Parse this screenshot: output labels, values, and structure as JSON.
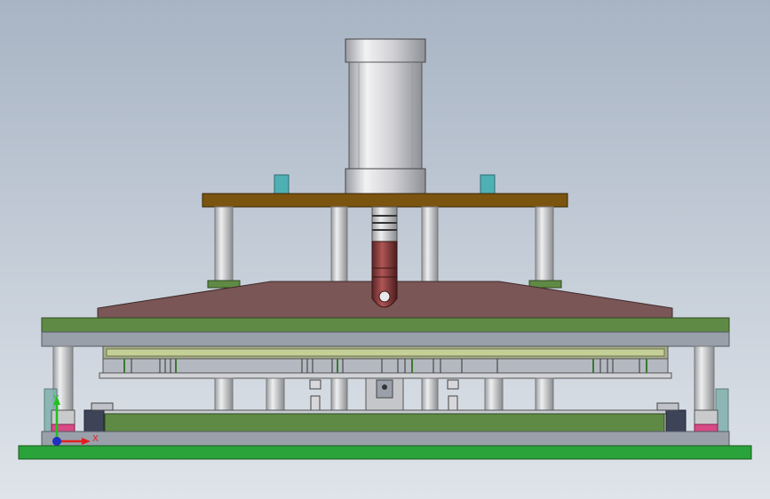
{
  "viewport": {
    "background_top": "#a8b4c4",
    "background_bottom": "#dfe4ea"
  },
  "colors": {
    "cylinder_body": "#d8d8dc",
    "brown_plate": "#7b5410",
    "teal_block": "#4fb0b4",
    "top_die_plate": "#7a5656",
    "green_plate": "#5f8a45",
    "grey_plate": "#9aa0aa",
    "bright_green_base": "#2aa33a",
    "guide_post": "#c8cacc",
    "dark_block": "#3e4458",
    "pink_block": "#d84a86"
  },
  "triad": {
    "x_label": "X",
    "y_label": "Y",
    "x_color": "#e02020",
    "y_color": "#20c020",
    "z_color": "#2030c0"
  }
}
